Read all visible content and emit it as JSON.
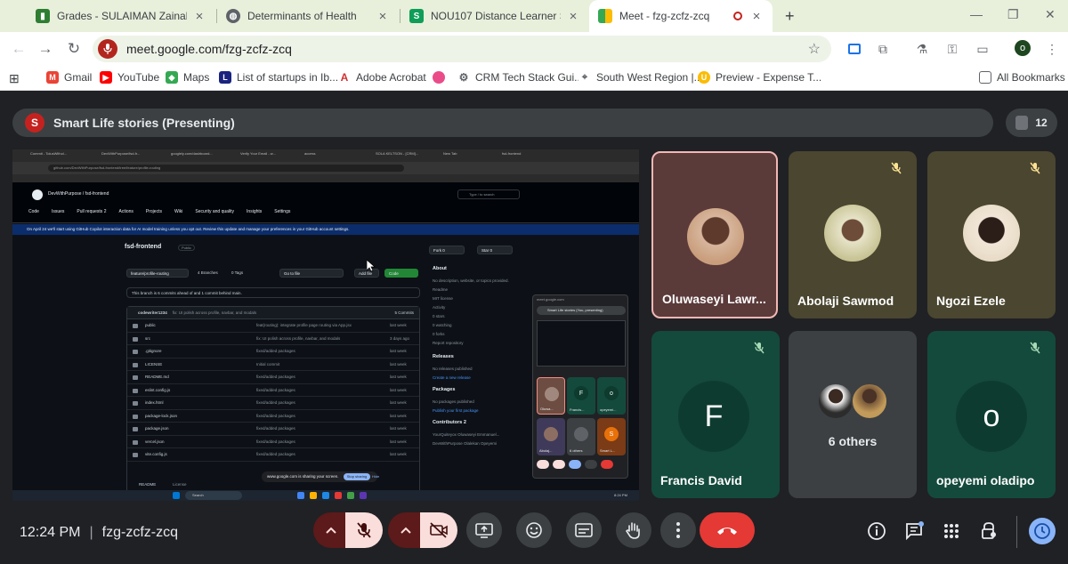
{
  "browser": {
    "tabs": [
      {
        "title": "Grades - SULAIMAN Zainab Op",
        "favicon": "green-bars-icon",
        "active": false
      },
      {
        "title": "Determinants of Health",
        "favicon": "globe-icon",
        "active": false
      },
      {
        "title": "NOU107 Distance Learner Studi",
        "favicon": "sheets-icon",
        "active": false
      },
      {
        "title": "Meet - fzg-zcfz-zcq",
        "favicon": "meet-icon",
        "active": true
      }
    ],
    "new_tab": "+",
    "url": "meet.google.com/fzg-zcfz-zcq",
    "profile_initial": "o",
    "bookmarks": [
      {
        "label": "Gmail",
        "icon": "gmail-icon"
      },
      {
        "label": "YouTube",
        "icon": "youtube-icon"
      },
      {
        "label": "Maps",
        "icon": "maps-icon"
      },
      {
        "label": "List of startups in Ib...",
        "icon": "page-icon"
      },
      {
        "label": "Adobe Acrobat",
        "icon": "acrobat-icon"
      },
      {
        "label": "",
        "icon": "dribbble-icon"
      },
      {
        "label": "CRM Tech Stack Gui...",
        "icon": "gear-icon"
      },
      {
        "label": "South West Region |...",
        "icon": "map-pin-icon"
      },
      {
        "label": "Preview - Expense T...",
        "icon": "preview-icon"
      }
    ],
    "all_bookmarks": "All Bookmarks"
  },
  "meet": {
    "presenter_initial": "S",
    "presenting_text": "Smart Life stories (Presenting)",
    "participant_count": "12",
    "shared_screen": {
      "tabs": [
        "Commit - TolusWithol...",
        "DevWithPurpose/fsd-fr...",
        "googlely.com/dashboard...",
        "Verify Your Email - w...",
        "access",
        "SOLA KELTSON - [CRM]...",
        "New Tab",
        "fsd-frontend"
      ],
      "url": "github.com/DevWithPurpose/fsd-frontend/tree/feature/profile-routing",
      "repo_path": "DevWithPurpose / fsd-frontend",
      "search_placeholder": "Type / to search",
      "nav": [
        "Code",
        "Issues",
        "Pull requests 2",
        "Actions",
        "Projects",
        "Wiki",
        "Security and quality",
        "Insights",
        "Settings"
      ],
      "banner": "On April 24 we'll start using GitHub Copilot interaction data for AI model training unless you opt out. Review this update and manage your preferences in your GitHub account settings.",
      "repo_name": "fsd-frontend",
      "visibility": "Public",
      "fork": "Fork 0",
      "star": "Star 0",
      "branch": "feature/profile-routing",
      "branches": "4 Branches",
      "tags": "0 Tags",
      "go_to_file": "Go to file",
      "add_file": "Add file",
      "code_btn": "Code",
      "ahead_text": "This branch is 6 commits ahead of and 1 commit behind main.",
      "commit_author": "codewriter1234",
      "commit_msg": "fix: UI polish across profile, navbar, and modals",
      "commit_count": "5 Commits",
      "files": [
        {
          "name": "public",
          "msg": "feat(routing): integrate profile page routing via App.jsx",
          "date": "last week"
        },
        {
          "name": "src",
          "msg": "fix: UI polish across profile, navbar, and modals",
          "date": "3 days ago"
        },
        {
          "name": ".gitignore",
          "msg": "fixed/added packages",
          "date": "last week"
        },
        {
          "name": "LICENSE",
          "msg": "Initial commit",
          "date": "last week"
        },
        {
          "name": "README.md",
          "msg": "fixed/added packages",
          "date": "last week"
        },
        {
          "name": "eslint.config.js",
          "msg": "fixed/added packages",
          "date": "last week"
        },
        {
          "name": "index.html",
          "msg": "fixed/added packages",
          "date": "last week"
        },
        {
          "name": "package-lock.json",
          "msg": "fixed/added packages",
          "date": "last week"
        },
        {
          "name": "package.json",
          "msg": "fixed/added packages",
          "date": "last week"
        },
        {
          "name": "vercel.json",
          "msg": "fixed/added packages",
          "date": "last week"
        },
        {
          "name": "vite.config.js",
          "msg": "fixed/added packages",
          "date": "last week"
        },
        {
          "name": "README",
          "msg": "License",
          "date": ""
        }
      ],
      "about": {
        "title": "About",
        "desc": "No description, website, or topics provided.",
        "links": [
          "Readme",
          "MIT license",
          "Activity",
          "0 stars",
          "0 watching",
          "0 forks",
          "Report repository"
        ],
        "releases_title": "Releases",
        "releases_text": "No releases published",
        "releases_link": "Create a new release",
        "packages_title": "Packages",
        "packages_text": "No packages published",
        "packages_link": "Publish your first package",
        "contributors_title": "Contributors 2",
        "contributors": [
          "YourQuiteyox Oluwaseyi Emmanuel...",
          "DevWithPurpose Olalekan Opeyemi"
        ]
      },
      "mini_meet": {
        "url": "meet.google.com",
        "title": "Smart Life stories (You, presenting)",
        "tiles": [
          "Oluwa...",
          "Francis...",
          "opeyemi...",
          "Abolaj...",
          "6 others",
          "Smart L..."
        ],
        "letters": [
          "F",
          "o",
          "S"
        ]
      },
      "notify": "www.google.com is sharing your screen.",
      "stop_sharing": "Stop sharing",
      "hide": "Hide",
      "search": "Search",
      "tray_time": "8:24 PM"
    },
    "participants": [
      {
        "name": "Oluwaseyi Lawr...",
        "kind": "photo",
        "active": true,
        "muted": false
      },
      {
        "name": "Abolaji Sawmod",
        "kind": "photo",
        "muted": true
      },
      {
        "name": "Ngozi Ezele",
        "kind": "photo",
        "muted": true
      },
      {
        "name": "Francis David",
        "kind": "letter",
        "letter": "F",
        "muted": true
      },
      {
        "name": "",
        "kind": "group",
        "others": "6 others",
        "muted": false
      },
      {
        "name": "opeyemi oladipo",
        "kind": "letter",
        "letter": "o",
        "muted": true
      }
    ]
  },
  "bottom": {
    "time": "12:24 PM",
    "meeting_code": "fzg-zcfz-zcq"
  },
  "colors": {
    "meet_bg": "#202124",
    "tile_green": "#144a3c",
    "tile_olive": "#4a4630",
    "leave_red": "#e53935",
    "mic_off_bg": "#f9dedc"
  }
}
